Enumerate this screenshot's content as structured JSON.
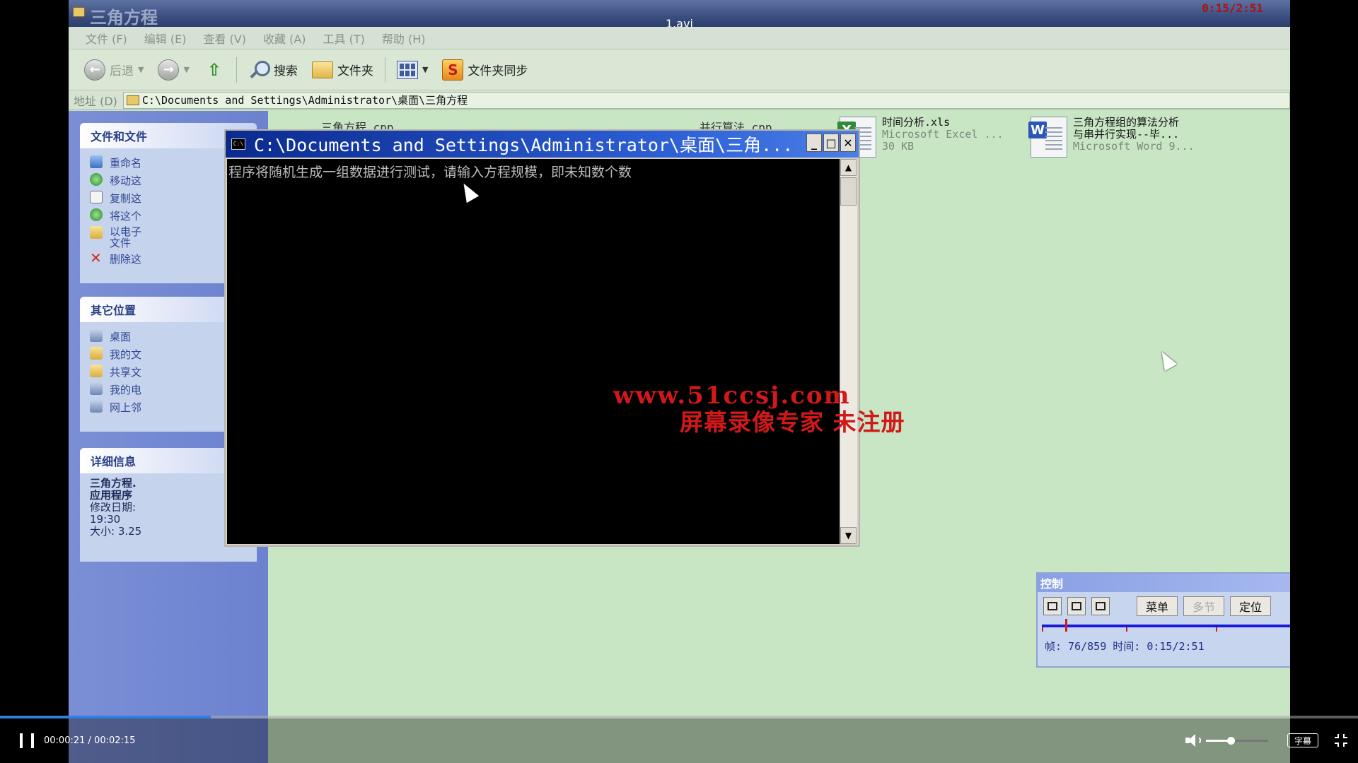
{
  "video": {
    "file_name": "1.avi",
    "recorder_time": "0:15/2:51"
  },
  "explorer": {
    "window_title": "三角方程",
    "menu": [
      "文件 (F)",
      "编辑 (E)",
      "查看 (V)",
      "收藏 (A)",
      "工具 (T)",
      "帮助 (H)"
    ],
    "toolbar": {
      "back_label": "后退",
      "search_label": "搜索",
      "folders_label": "文件夹",
      "sync_label": "文件夹同步"
    },
    "address": {
      "label": "地址 (D)",
      "path": "C:\\Documents and Settings\\Administrator\\桌面\\三角方程"
    },
    "task_pane": {
      "file_tasks": {
        "title": "文件和文件",
        "items": [
          "重命名",
          "移动这",
          "复制这",
          "将这个",
          "以电子",
          "删除这"
        ],
        "item_extra": "文件"
      },
      "other_places": {
        "title": "其它位置",
        "items": [
          "桌面",
          "我的文",
          "共享文",
          "我的电",
          "网上邻"
        ]
      },
      "details": {
        "title": "详细信息",
        "name_line1": "三角方程.",
        "name_line2": "应用程序",
        "modified_label": "修改日期:",
        "modified_value": "19:30",
        "size_text": "大小: 3.25"
      }
    },
    "files": [
      {
        "name": "时间分析.xls",
        "type": "Microsoft Excel ...",
        "size": "30 KB",
        "icon": "excel-icon"
      },
      {
        "name_line1": "三角方程组的算法分析",
        "name_line2": "与串并行实现--毕...",
        "type": "Microsoft Word 9...",
        "icon": "word-icon"
      }
    ],
    "partial_files": [
      "三角方程.cpp",
      "并行算法.cpp"
    ]
  },
  "console": {
    "title": "C:\\Documents and Settings\\Administrator\\桌面\\三角...",
    "output_line": "程序将随机生成一组数据进行测试，请输入方程规模，即未知数个数"
  },
  "watermark": {
    "url": "www.51ccsj.com",
    "note": "屏幕录像专家  未注册"
  },
  "control_panel": {
    "title": "控制",
    "menu_label": "菜单",
    "multi_label": "多节",
    "locate_label": "定位",
    "frame_info": "帧: 76/859 时间: 0:15/2:51",
    "position_fraction": 0.088
  },
  "player": {
    "current_time": "00:00:21",
    "total_time": "00:02:15",
    "time_separator": " / ",
    "progress_fraction": 0.155,
    "volume_fraction": 0.4,
    "subtitle_label": "字幕"
  },
  "colors": {
    "progress": "#2e7fe0",
    "watermark": "#d11919",
    "console_bg": "#000000",
    "desktop_bg": "#c8e6c4"
  }
}
